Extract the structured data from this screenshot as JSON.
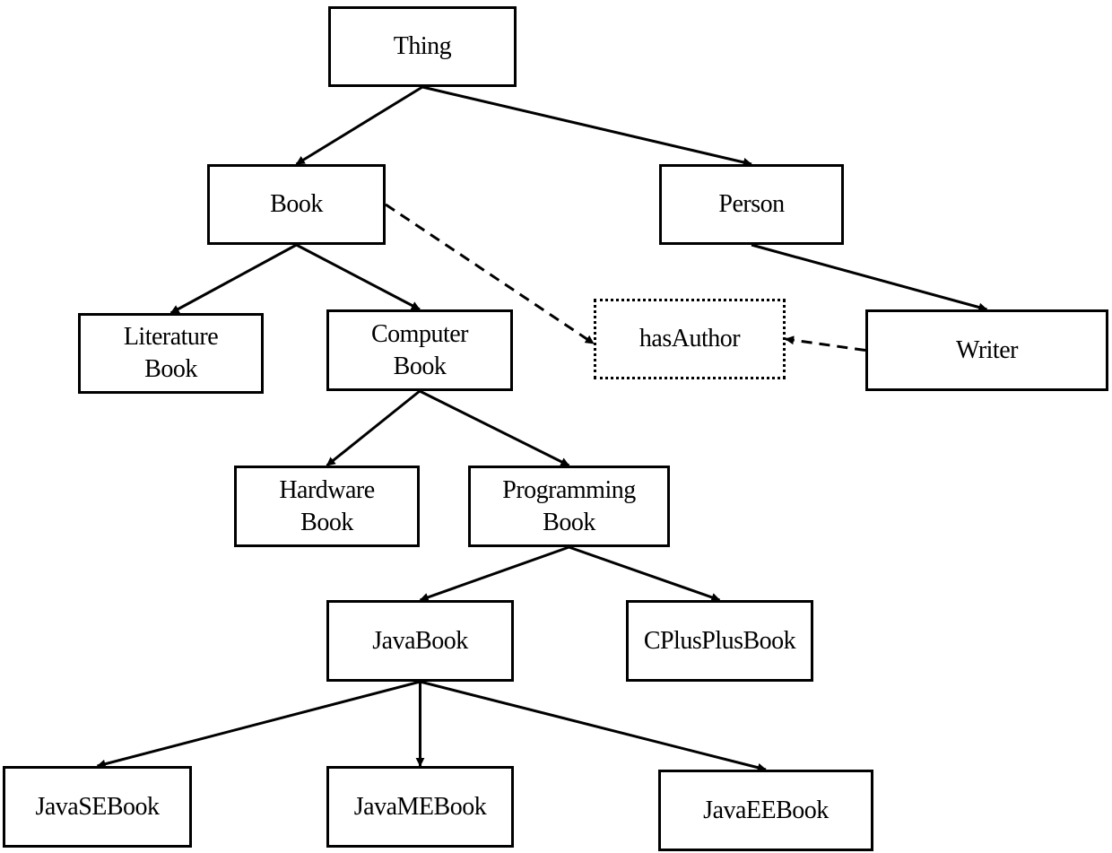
{
  "diagram": {
    "nodes": {
      "thing": {
        "label": "Thing",
        "style": "solid"
      },
      "book": {
        "label": "Book",
        "style": "solid"
      },
      "person": {
        "label": "Person",
        "style": "solid"
      },
      "literature_book": {
        "label": "Literature\nBook",
        "style": "solid"
      },
      "computer_book": {
        "label": "Computer\nBook",
        "style": "solid"
      },
      "has_author": {
        "label": "hasAuthor",
        "style": "dotted"
      },
      "writer": {
        "label": "Writer",
        "style": "solid"
      },
      "hardware_book": {
        "label": "Hardware\nBook",
        "style": "solid"
      },
      "programming_book": {
        "label": "Programming\nBook",
        "style": "solid"
      },
      "java_book": {
        "label": "JavaBook",
        "style": "solid"
      },
      "cplusplus_book": {
        "label": "CPlusPlusBook",
        "style": "solid"
      },
      "javase_book": {
        "label": "JavaSEBook",
        "style": "solid"
      },
      "javame_book": {
        "label": "JavaMEBook",
        "style": "solid"
      },
      "javaee_book": {
        "label": "JavaEEBook",
        "style": "solid"
      }
    },
    "edges": [
      {
        "from": "thing",
        "to": "book",
        "type": "solid"
      },
      {
        "from": "thing",
        "to": "person",
        "type": "solid"
      },
      {
        "from": "book",
        "to": "literature_book",
        "type": "solid"
      },
      {
        "from": "book",
        "to": "computer_book",
        "type": "solid"
      },
      {
        "from": "book",
        "to": "has_author",
        "type": "dashed"
      },
      {
        "from": "person",
        "to": "writer",
        "type": "solid"
      },
      {
        "from": "writer",
        "to": "has_author",
        "type": "dashed"
      },
      {
        "from": "computer_book",
        "to": "hardware_book",
        "type": "solid"
      },
      {
        "from": "computer_book",
        "to": "programming_book",
        "type": "solid"
      },
      {
        "from": "programming_book",
        "to": "java_book",
        "type": "solid"
      },
      {
        "from": "programming_book",
        "to": "cplusplus_book",
        "type": "solid"
      },
      {
        "from": "java_book",
        "to": "javase_book",
        "type": "solid"
      },
      {
        "from": "java_book",
        "to": "javame_book",
        "type": "solid"
      },
      {
        "from": "java_book",
        "to": "javaee_book",
        "type": "solid"
      }
    ]
  }
}
